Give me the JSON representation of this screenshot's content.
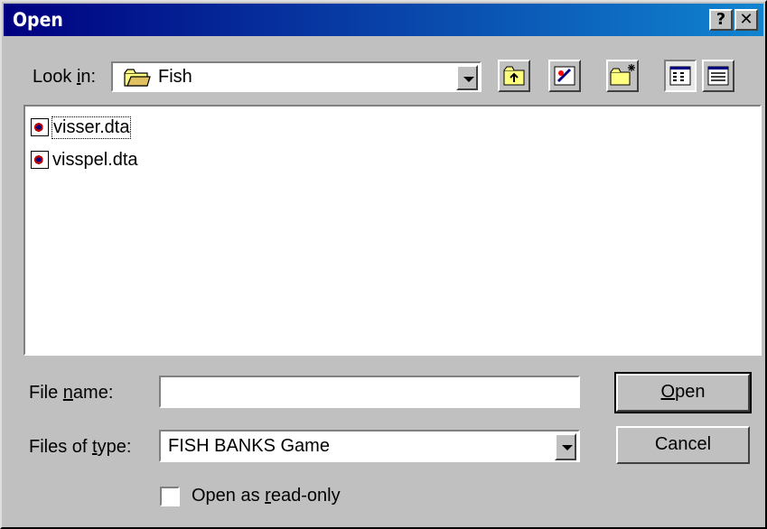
{
  "window": {
    "title": "Open",
    "help_button": "?",
    "close_button": "✕"
  },
  "look_in": {
    "label_pre": "Look ",
    "label_key": "i",
    "label_post": "n:",
    "value": "Fish"
  },
  "files": [
    {
      "name": "visser.dta"
    },
    {
      "name": "visspel.dta"
    }
  ],
  "file_name": {
    "label_pre": "File ",
    "label_key": "n",
    "label_post": "ame:",
    "value": ""
  },
  "files_of_type": {
    "label_pre": "Files of ",
    "label_key": "t",
    "label_post": "ype:",
    "value": "FISH BANKS Game"
  },
  "read_only": {
    "label_pre": "Open as ",
    "label_key": "r",
    "label_post": "ead-only",
    "checked": false
  },
  "buttons": {
    "open_key": "O",
    "open_rest": "pen",
    "cancel": "Cancel"
  },
  "colors": {
    "face": "#c0c0c0",
    "title_start": "#000080",
    "title_end": "#1084d0"
  },
  "icons": [
    "folder-icon",
    "up-one-level-icon",
    "desktop-icon",
    "new-folder-icon",
    "list-view-icon",
    "details-view-icon",
    "file-icon"
  ]
}
